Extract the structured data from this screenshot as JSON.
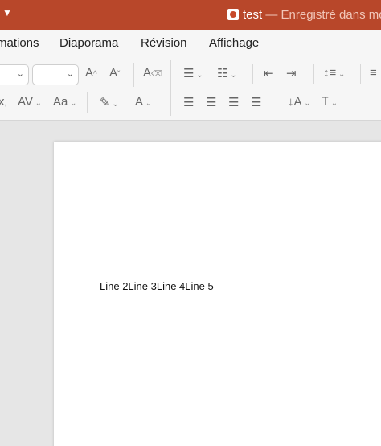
{
  "titlebar": {
    "doc_name": "test",
    "doc_status": " — Enregistré dans mo"
  },
  "menu": {
    "tabs": [
      "mations",
      "Diaporama",
      "Révision",
      "Affichage"
    ]
  },
  "ribbon": {
    "char_spacing_label": "AV",
    "change_case_label": "Aa"
  },
  "slide": {
    "text": "Line 2Line 3Line 4Line 5"
  },
  "colors": {
    "titlebar_bg": "#b8472a",
    "ribbon_bg": "#f6f6f6",
    "editor_bg": "#e6e6e6",
    "slide_bg": "#ffffff"
  }
}
